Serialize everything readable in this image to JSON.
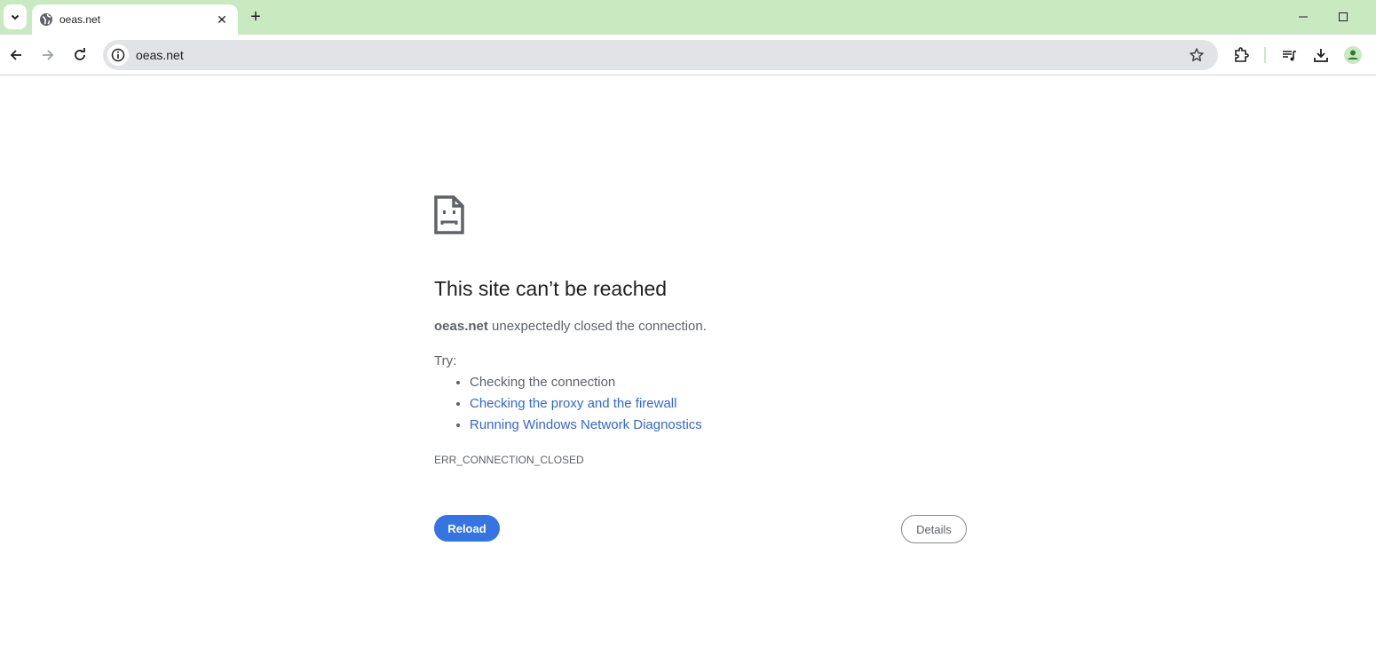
{
  "browser": {
    "tab": {
      "title": "oeas.net",
      "icon": "globe-icon"
    },
    "address": "oeas.net",
    "accent": "#c9eac1"
  },
  "error": {
    "icon": "sad-document-icon",
    "title": "This site can’t be reached",
    "host": "oeas.net",
    "message": " unexpectedly closed the connection.",
    "try_label": "Try:",
    "suggestions": [
      {
        "text": "Checking the connection",
        "link": false
      },
      {
        "text": "Checking the proxy and the firewall",
        "link": true
      },
      {
        "text": "Running Windows Network Diagnostics",
        "link": true
      }
    ],
    "code": "ERR_CONNECTION_CLOSED",
    "reload_label": "Reload",
    "details_label": "Details",
    "reload_color": "#3574e3",
    "link_color": "#3367d6"
  }
}
